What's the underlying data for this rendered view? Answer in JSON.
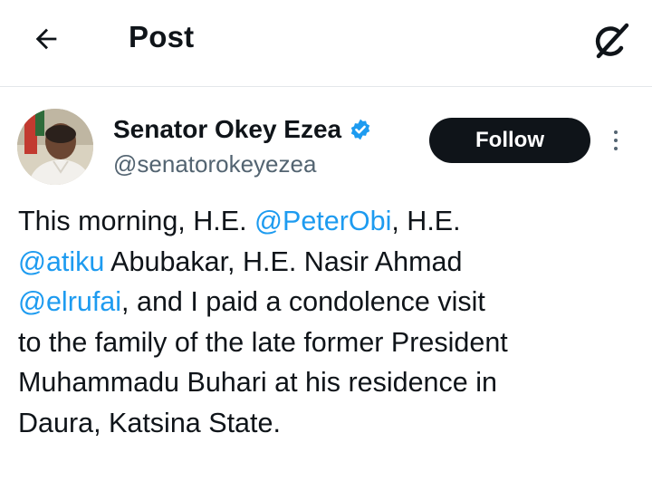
{
  "header": {
    "title": "Post",
    "back_icon": "arrow-left-icon",
    "grok_icon": "grok-slash-icon"
  },
  "author": {
    "display_name": "Senator Okey Ezea",
    "handle": "@senatorokeyezea",
    "verified": true,
    "verified_color": "#1d9bf0"
  },
  "actions": {
    "follow_label": "Follow",
    "more_icon": "more-vertical-icon"
  },
  "tweet": {
    "lines": [
      [
        {
          "t": "This morning, H.E. "
        },
        {
          "t": "@PeterObi",
          "m": true
        },
        {
          "t": ", H.E."
        }
      ],
      [
        {
          "t": "@atiku",
          "m": true
        },
        {
          "t": " Abubakar, H.E. Nasir Ahmad"
        }
      ],
      [
        {
          "t": "@elrufai",
          "m": true
        },
        {
          "t": ", and I paid a condolence visit"
        }
      ],
      [
        {
          "t": "to the family of the late former President"
        }
      ],
      [
        {
          "t": "Muhammadu Buhari at his residence in"
        }
      ],
      [
        {
          "t": "Daura, Katsina State."
        }
      ]
    ]
  },
  "colors": {
    "mention": "#1d9bf0",
    "text_primary": "#0f1419",
    "text_secondary": "#536471",
    "button_bg": "#0f1419"
  }
}
